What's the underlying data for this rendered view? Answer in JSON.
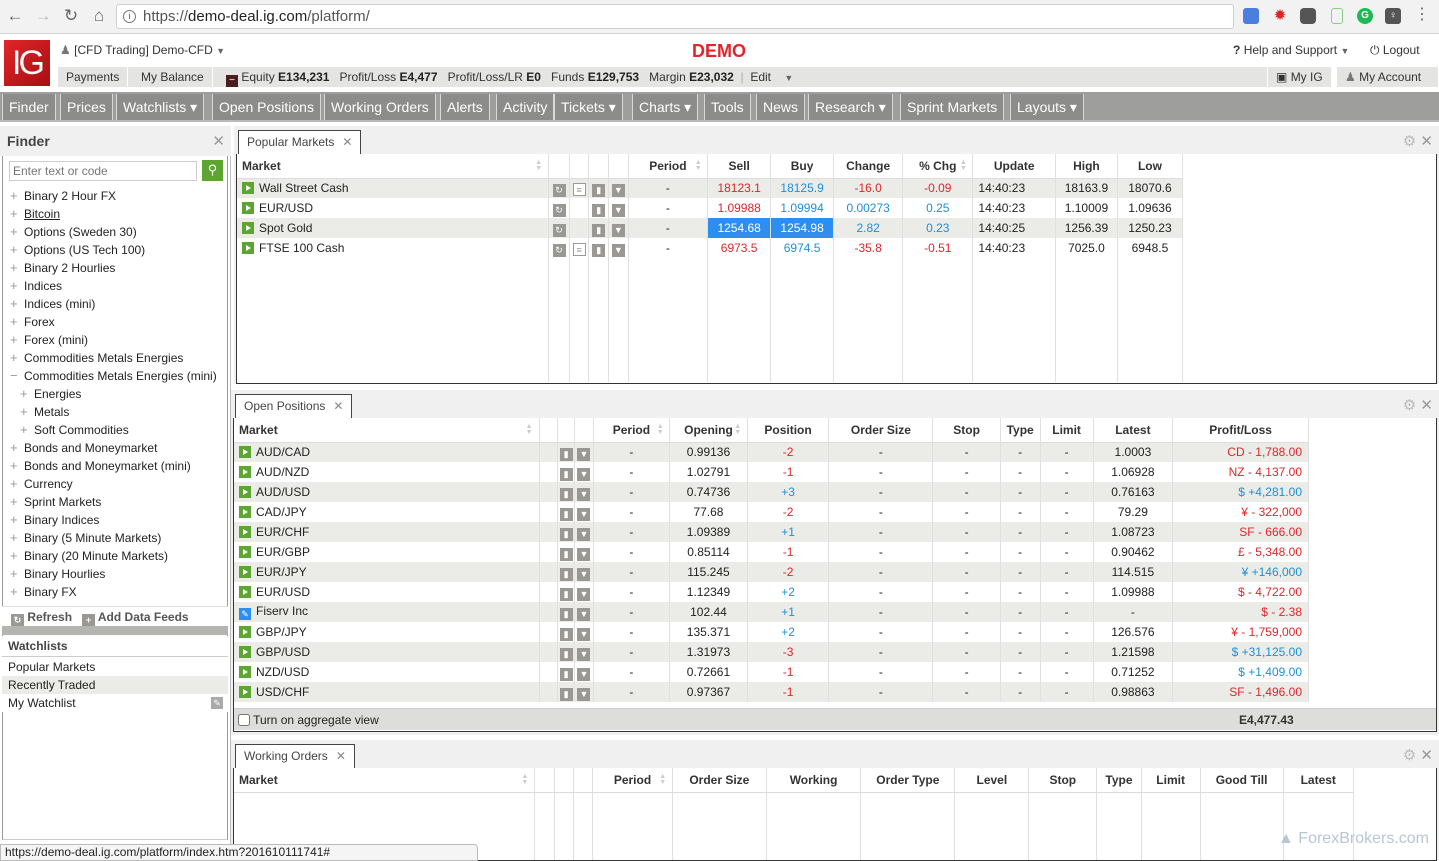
{
  "browser": {
    "url_prefix": "https://",
    "url_domain": "demo-deal.ig.com",
    "url_path": "/platform/",
    "status_url": "https://demo-deal.ig.com/platform/index.htm?201610111741#"
  },
  "header": {
    "logo": "IG",
    "account_label": "[CFD Trading] Demo-CFD",
    "mode_label": "DEMO",
    "help_label": "Help and Support",
    "logout_label": "Logout",
    "my_ig_label": "My IG",
    "my_account_label": "My Account"
  },
  "infobar": {
    "payments": "Payments",
    "my_balance": "My Balance",
    "equity_label": "Equity",
    "equity_value": "E134,231",
    "pl_label": "Profit/Loss",
    "pl_value": "E4,477",
    "pllr_label": "Profit/Loss/LR",
    "pllr_value": "E0",
    "funds_label": "Funds",
    "funds_value": "E129,753",
    "margin_label": "Margin",
    "margin_value": "E23,032",
    "edit_label": "Edit"
  },
  "mainnav": [
    {
      "label": "Finder"
    },
    {
      "label": "Prices"
    },
    {
      "label": "Watchlists ▾"
    },
    {
      "label": "Open Positions"
    },
    {
      "label": "Working Orders"
    },
    {
      "label": "Alerts"
    },
    {
      "label": "Activity"
    },
    {
      "label": "Tickets ▾"
    },
    {
      "label": "Charts ▾"
    },
    {
      "label": "Tools"
    },
    {
      "label": "News"
    },
    {
      "label": "Research ▾"
    },
    {
      "label": "Sprint Markets"
    },
    {
      "label": "Layouts ▾"
    }
  ],
  "finder": {
    "title": "Finder",
    "search_placeholder": "Enter text or code",
    "tree": [
      {
        "label": "Binary 2 Hour FX",
        "sign": "+",
        "indent": false
      },
      {
        "label": "Bitcoin",
        "sign": "+",
        "indent": false,
        "underline": true
      },
      {
        "label": "Options (Sweden 30)",
        "sign": "+",
        "indent": false
      },
      {
        "label": "Options (US Tech 100)",
        "sign": "+",
        "indent": false
      },
      {
        "label": "Binary 2 Hourlies",
        "sign": "+",
        "indent": false
      },
      {
        "label": "Indices",
        "sign": "+",
        "indent": false
      },
      {
        "label": "Indices (mini)",
        "sign": "+",
        "indent": false
      },
      {
        "label": "Forex",
        "sign": "+",
        "indent": false
      },
      {
        "label": "Forex (mini)",
        "sign": "+",
        "indent": false
      },
      {
        "label": "Commodities Metals Energies",
        "sign": "+",
        "indent": false
      },
      {
        "label": "Commodities Metals Energies (mini)",
        "sign": "−",
        "indent": false
      },
      {
        "label": "Energies",
        "sign": "+",
        "indent": true
      },
      {
        "label": "Metals",
        "sign": "+",
        "indent": true
      },
      {
        "label": "Soft Commodities",
        "sign": "+",
        "indent": true
      },
      {
        "label": "Bonds and Moneymarket",
        "sign": "+",
        "indent": false
      },
      {
        "label": "Bonds and Moneymarket (mini)",
        "sign": "+",
        "indent": false
      },
      {
        "label": "Currency",
        "sign": "+",
        "indent": false
      },
      {
        "label": "Sprint Markets",
        "sign": "+",
        "indent": false
      },
      {
        "label": "Binary Indices",
        "sign": "+",
        "indent": false
      },
      {
        "label": "Binary (5 Minute Markets)",
        "sign": "+",
        "indent": false
      },
      {
        "label": "Binary (20 Minute Markets)",
        "sign": "+",
        "indent": false
      },
      {
        "label": "Binary Hourlies",
        "sign": "+",
        "indent": false
      },
      {
        "label": "Binary FX",
        "sign": "+",
        "indent": false
      }
    ],
    "refresh_label": "Refresh",
    "add_feeds_label": "Add Data Feeds",
    "watchlists_title": "Watchlists",
    "watchlists": [
      "Popular Markets",
      "Recently Traded",
      "My Watchlist"
    ]
  },
  "popular": {
    "tab_label": "Popular Markets",
    "columns": [
      "Market",
      "",
      "",
      "",
      "",
      "Period",
      "Sell",
      "Buy",
      "Change",
      "% Chg",
      "Update",
      "High",
      "Low"
    ],
    "rows": [
      {
        "market": "Wall Street Cash",
        "news": true,
        "period": "-",
        "sell": "18123.1",
        "buy": "18125.9",
        "change": "-16.0",
        "pct": "-0.09",
        "update": "14:40:23",
        "high": "18163.9",
        "low": "18070.6",
        "dir": "neg",
        "highlight": false
      },
      {
        "market": "EUR/USD",
        "news": false,
        "period": "-",
        "sell": "1.09988",
        "buy": "1.09994",
        "change": "0.00273",
        "pct": "0.25",
        "update": "14:40:23",
        "high": "1.10009",
        "low": "1.09636",
        "dir": "pos",
        "highlight": false
      },
      {
        "market": "Spot Gold",
        "news": false,
        "period": "-",
        "sell": "1254.68",
        "buy": "1254.98",
        "change": "2.82",
        "pct": "0.23",
        "update": "14:40:25",
        "high": "1256.39",
        "low": "1250.23",
        "dir": "pos",
        "highlight": true
      },
      {
        "market": "FTSE 100 Cash",
        "news": true,
        "period": "-",
        "sell": "6973.5",
        "buy": "6974.5",
        "change": "-35.8",
        "pct": "-0.51",
        "update": "14:40:23",
        "high": "7025.0",
        "low": "6948.5",
        "dir": "neg",
        "highlight": false
      }
    ]
  },
  "positions": {
    "tab_label": "Open Positions",
    "columns": [
      "Market",
      "",
      "",
      "",
      "Period",
      "Opening",
      "Position",
      "Order Size",
      "Stop",
      "Type",
      "Limit",
      "Latest",
      "Profit/Loss"
    ],
    "rows": [
      {
        "market": "AUD/CAD",
        "icon": "play",
        "period": "-",
        "opening": "0.99136",
        "position": "-2",
        "latest": "1.0003",
        "pl": "CD - 1,788.00",
        "pl_dir": "neg"
      },
      {
        "market": "AUD/NZD",
        "icon": "play",
        "period": "-",
        "opening": "1.02791",
        "position": "-1",
        "latest": "1.06928",
        "pl": "NZ - 4,137.00",
        "pl_dir": "neg"
      },
      {
        "market": "AUD/USD",
        "icon": "play",
        "period": "-",
        "opening": "0.74736",
        "position": "+3",
        "latest": "0.76163",
        "pl": "$ +4,281.00",
        "pl_dir": "pos"
      },
      {
        "market": "CAD/JPY",
        "icon": "play",
        "period": "-",
        "opening": "77.68",
        "position": "-2",
        "latest": "79.29",
        "pl": "¥ - 322,000",
        "pl_dir": "neg"
      },
      {
        "market": "EUR/CHF",
        "icon": "play",
        "period": "-",
        "opening": "1.09389",
        "position": "+1",
        "latest": "1.08723",
        "pl": "SF - 666.00",
        "pl_dir": "neg"
      },
      {
        "market": "EUR/GBP",
        "icon": "play",
        "period": "-",
        "opening": "0.85114",
        "position": "-1",
        "latest": "0.90462",
        "pl": "£ - 5,348.00",
        "pl_dir": "neg"
      },
      {
        "market": "EUR/JPY",
        "icon": "play",
        "period": "-",
        "opening": "115.245",
        "position": "-2",
        "latest": "114.515",
        "pl": "¥ +146,000",
        "pl_dir": "pos"
      },
      {
        "market": "EUR/USD",
        "icon": "play",
        "period": "-",
        "opening": "1.12349",
        "position": "+2",
        "latest": "1.09988",
        "pl": "$ - 4,722.00",
        "pl_dir": "neg"
      },
      {
        "market": "Fiserv Inc",
        "icon": "pen",
        "period": "-",
        "opening": "102.44",
        "position": "+1",
        "latest": "-",
        "pl": "$ - 2.38",
        "pl_dir": "neg"
      },
      {
        "market": "GBP/JPY",
        "icon": "play",
        "period": "-",
        "opening": "135.371",
        "position": "+2",
        "latest": "126.576",
        "pl": "¥ - 1,759,000",
        "pl_dir": "neg"
      },
      {
        "market": "GBP/USD",
        "icon": "play",
        "period": "-",
        "opening": "1.31973",
        "position": "-3",
        "latest": "1.21598",
        "pl": "$ +31,125.00",
        "pl_dir": "pos"
      },
      {
        "market": "NZD/USD",
        "icon": "play",
        "period": "-",
        "opening": "0.72661",
        "position": "-1",
        "latest": "0.71252",
        "pl": "$ +1,409.00",
        "pl_dir": "pos"
      },
      {
        "market": "USD/CHF",
        "icon": "play",
        "period": "-",
        "opening": "0.97367",
        "position": "-1",
        "latest": "0.98863",
        "pl": "SF - 1,496.00",
        "pl_dir": "neg"
      }
    ],
    "aggregate_label": "Turn on aggregate view",
    "total": "E4,477.43"
  },
  "orders": {
    "tab_label": "Working Orders",
    "columns": [
      "Market",
      "",
      "",
      "",
      "Period",
      "Order Size",
      "Working",
      "Order Type",
      "Level",
      "Stop",
      "Type",
      "Limit",
      "Good Till",
      "Latest"
    ]
  },
  "watermark": "ForexBrokers.com"
}
